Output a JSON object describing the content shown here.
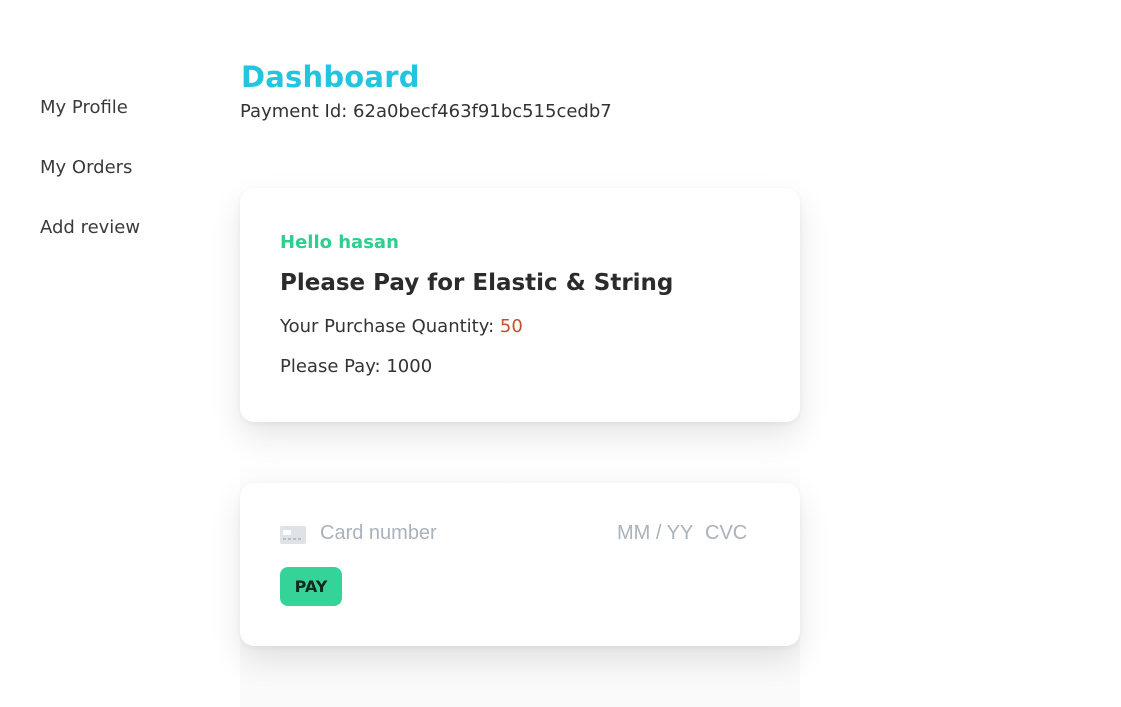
{
  "sidebar": {
    "items": [
      {
        "label": "My Profile"
      },
      {
        "label": "My Orders"
      },
      {
        "label": "Add review"
      }
    ]
  },
  "main": {
    "title": "Dashboard",
    "payment_id": "Payment Id: 62a0becf463f91bc515cedb7"
  },
  "order": {
    "greeting": "Hello hasan",
    "product_title": "Please Pay for Elastic & String",
    "quantity_label": "Your Purchase Quantity: ",
    "quantity_value": "50",
    "amount_text": "Please Pay: 1000"
  },
  "payment": {
    "card_brand_icon": "generic-card-icon",
    "card_number_placeholder": "Card number",
    "expiry_placeholder": "MM / YY",
    "cvc_placeholder": "CVC",
    "pay_label": "PAY"
  },
  "colors": {
    "title": "#23c4e0",
    "greeting": "#2fce8f",
    "quantity_value": "#c1502e",
    "pay_button": "#36d399",
    "placeholder": "#a9b2bd"
  }
}
